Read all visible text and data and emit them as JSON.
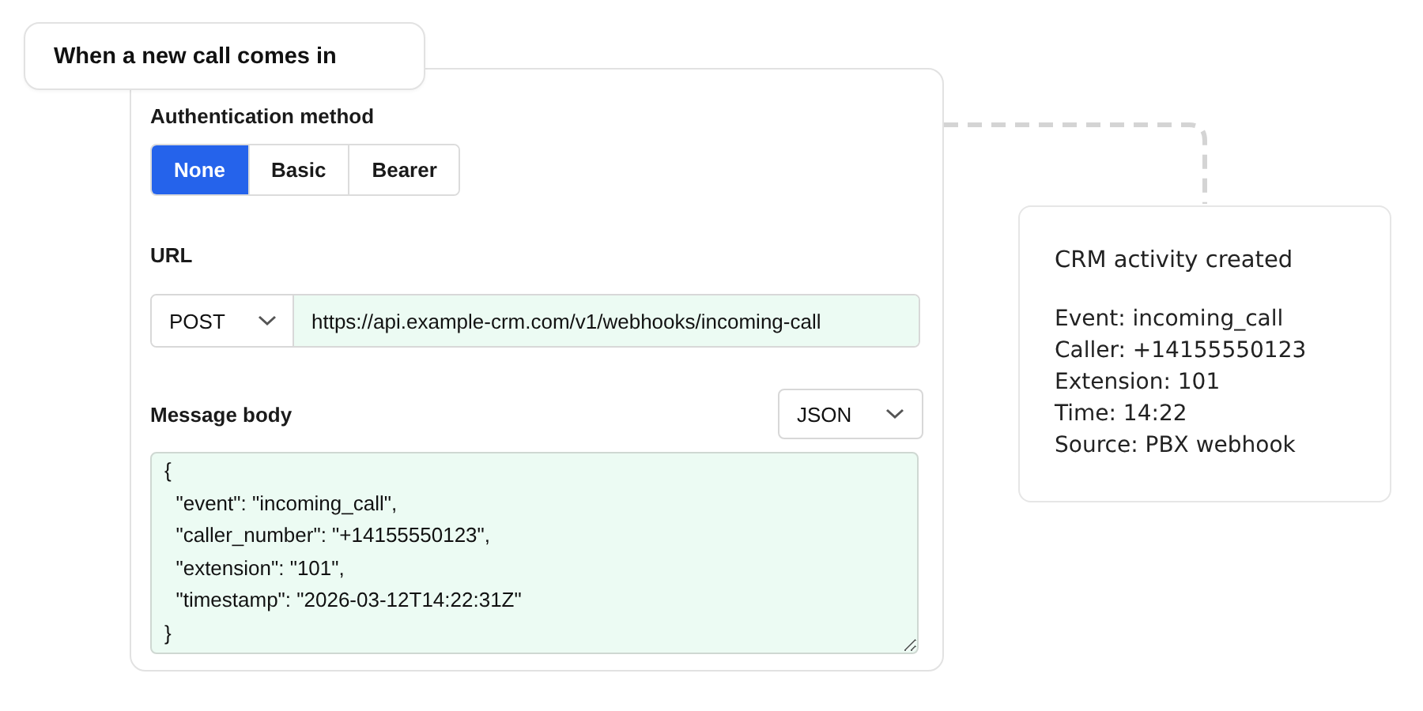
{
  "trigger": {
    "title": "When a new call comes in"
  },
  "auth": {
    "label": "Authentication method",
    "options": [
      {
        "label": "None",
        "selected": true
      },
      {
        "label": "Basic",
        "selected": false
      },
      {
        "label": "Bearer",
        "selected": false
      }
    ]
  },
  "url": {
    "label": "URL",
    "method": "POST",
    "value": "https://api.example-crm.com/v1/webhooks/incoming-call"
  },
  "body": {
    "label": "Message body",
    "format": "JSON",
    "lines": [
      "{",
      "  \"event\": \"incoming_call\",",
      "  \"caller_number\": \"+14155550123\",",
      "  \"extension\": \"101\",",
      "  \"timestamp\": \"2026-03-12T14:22:31Z\"",
      "}"
    ]
  },
  "result": {
    "title": "CRM activity created",
    "lines": [
      "Event: incoming_call",
      "Caller: +14155550123",
      "Extension: 101",
      "Time: 14:22",
      "Source: PBX webhook"
    ]
  }
}
